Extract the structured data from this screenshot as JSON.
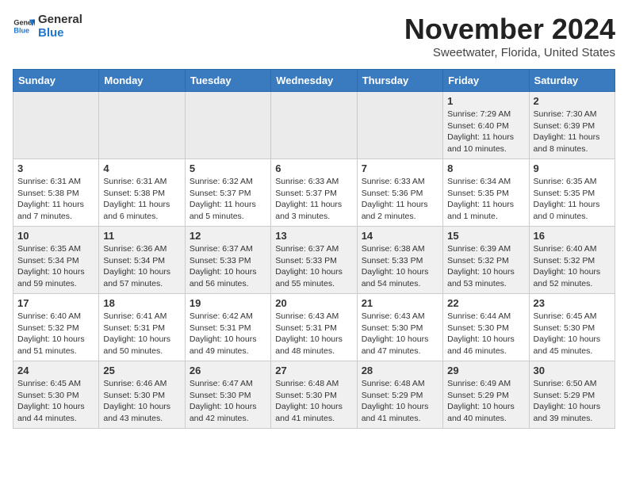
{
  "header": {
    "logo_line1": "General",
    "logo_line2": "Blue",
    "month_title": "November 2024",
    "subtitle": "Sweetwater, Florida, United States"
  },
  "weekdays": [
    "Sunday",
    "Monday",
    "Tuesday",
    "Wednesday",
    "Thursday",
    "Friday",
    "Saturday"
  ],
  "weeks": [
    [
      {
        "day": "",
        "info": ""
      },
      {
        "day": "",
        "info": ""
      },
      {
        "day": "",
        "info": ""
      },
      {
        "day": "",
        "info": ""
      },
      {
        "day": "",
        "info": ""
      },
      {
        "day": "1",
        "info": "Sunrise: 7:29 AM\nSunset: 6:40 PM\nDaylight: 11 hours and 10 minutes."
      },
      {
        "day": "2",
        "info": "Sunrise: 7:30 AM\nSunset: 6:39 PM\nDaylight: 11 hours and 8 minutes."
      }
    ],
    [
      {
        "day": "3",
        "info": "Sunrise: 6:31 AM\nSunset: 5:38 PM\nDaylight: 11 hours and 7 minutes."
      },
      {
        "day": "4",
        "info": "Sunrise: 6:31 AM\nSunset: 5:38 PM\nDaylight: 11 hours and 6 minutes."
      },
      {
        "day": "5",
        "info": "Sunrise: 6:32 AM\nSunset: 5:37 PM\nDaylight: 11 hours and 5 minutes."
      },
      {
        "day": "6",
        "info": "Sunrise: 6:33 AM\nSunset: 5:37 PM\nDaylight: 11 hours and 3 minutes."
      },
      {
        "day": "7",
        "info": "Sunrise: 6:33 AM\nSunset: 5:36 PM\nDaylight: 11 hours and 2 minutes."
      },
      {
        "day": "8",
        "info": "Sunrise: 6:34 AM\nSunset: 5:35 PM\nDaylight: 11 hours and 1 minute."
      },
      {
        "day": "9",
        "info": "Sunrise: 6:35 AM\nSunset: 5:35 PM\nDaylight: 11 hours and 0 minutes."
      }
    ],
    [
      {
        "day": "10",
        "info": "Sunrise: 6:35 AM\nSunset: 5:34 PM\nDaylight: 10 hours and 59 minutes."
      },
      {
        "day": "11",
        "info": "Sunrise: 6:36 AM\nSunset: 5:34 PM\nDaylight: 10 hours and 57 minutes."
      },
      {
        "day": "12",
        "info": "Sunrise: 6:37 AM\nSunset: 5:33 PM\nDaylight: 10 hours and 56 minutes."
      },
      {
        "day": "13",
        "info": "Sunrise: 6:37 AM\nSunset: 5:33 PM\nDaylight: 10 hours and 55 minutes."
      },
      {
        "day": "14",
        "info": "Sunrise: 6:38 AM\nSunset: 5:33 PM\nDaylight: 10 hours and 54 minutes."
      },
      {
        "day": "15",
        "info": "Sunrise: 6:39 AM\nSunset: 5:32 PM\nDaylight: 10 hours and 53 minutes."
      },
      {
        "day": "16",
        "info": "Sunrise: 6:40 AM\nSunset: 5:32 PM\nDaylight: 10 hours and 52 minutes."
      }
    ],
    [
      {
        "day": "17",
        "info": "Sunrise: 6:40 AM\nSunset: 5:32 PM\nDaylight: 10 hours and 51 minutes."
      },
      {
        "day": "18",
        "info": "Sunrise: 6:41 AM\nSunset: 5:31 PM\nDaylight: 10 hours and 50 minutes."
      },
      {
        "day": "19",
        "info": "Sunrise: 6:42 AM\nSunset: 5:31 PM\nDaylight: 10 hours and 49 minutes."
      },
      {
        "day": "20",
        "info": "Sunrise: 6:43 AM\nSunset: 5:31 PM\nDaylight: 10 hours and 48 minutes."
      },
      {
        "day": "21",
        "info": "Sunrise: 6:43 AM\nSunset: 5:30 PM\nDaylight: 10 hours and 47 minutes."
      },
      {
        "day": "22",
        "info": "Sunrise: 6:44 AM\nSunset: 5:30 PM\nDaylight: 10 hours and 46 minutes."
      },
      {
        "day": "23",
        "info": "Sunrise: 6:45 AM\nSunset: 5:30 PM\nDaylight: 10 hours and 45 minutes."
      }
    ],
    [
      {
        "day": "24",
        "info": "Sunrise: 6:45 AM\nSunset: 5:30 PM\nDaylight: 10 hours and 44 minutes."
      },
      {
        "day": "25",
        "info": "Sunrise: 6:46 AM\nSunset: 5:30 PM\nDaylight: 10 hours and 43 minutes."
      },
      {
        "day": "26",
        "info": "Sunrise: 6:47 AM\nSunset: 5:30 PM\nDaylight: 10 hours and 42 minutes."
      },
      {
        "day": "27",
        "info": "Sunrise: 6:48 AM\nSunset: 5:30 PM\nDaylight: 10 hours and 41 minutes."
      },
      {
        "day": "28",
        "info": "Sunrise: 6:48 AM\nSunset: 5:29 PM\nDaylight: 10 hours and 41 minutes."
      },
      {
        "day": "29",
        "info": "Sunrise: 6:49 AM\nSunset: 5:29 PM\nDaylight: 10 hours and 40 minutes."
      },
      {
        "day": "30",
        "info": "Sunrise: 6:50 AM\nSunset: 5:29 PM\nDaylight: 10 hours and 39 minutes."
      }
    ]
  ]
}
